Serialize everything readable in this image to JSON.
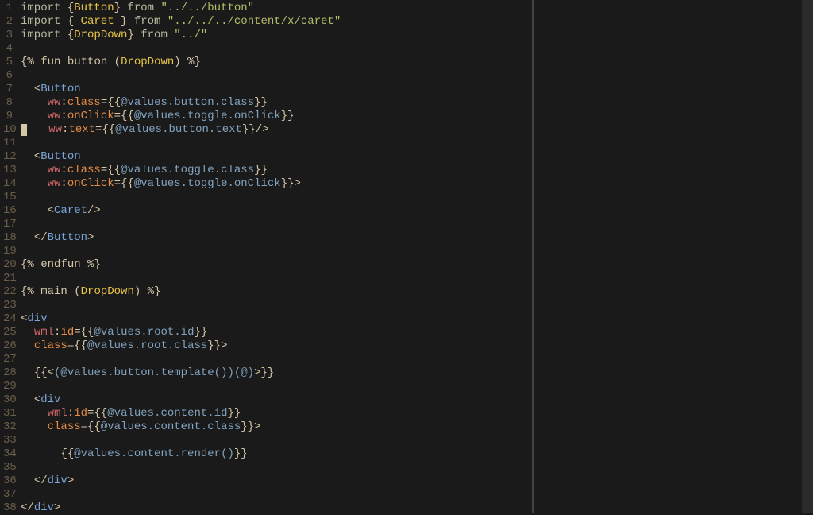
{
  "editor": {
    "current_line": 10,
    "line_numbers": [
      "1",
      "2",
      "3",
      "4",
      "5",
      "6",
      "7",
      "8",
      "9",
      "10",
      "11",
      "12",
      "13",
      "14",
      "15",
      "16",
      "17",
      "18",
      "19",
      "20",
      "21",
      "22",
      "23",
      "24",
      "25",
      "26",
      "27",
      "28",
      "29",
      "30",
      "31",
      "32",
      "33",
      "34",
      "35",
      "36",
      "37",
      "38"
    ],
    "lines": [
      {
        "indent": "",
        "tokens": [
          {
            "t": "import ",
            "c": "tok-import-kw"
          },
          {
            "t": "{",
            "c": "tok-punct"
          },
          {
            "t": "Button",
            "c": "tok-type"
          },
          {
            "t": "}",
            "c": "tok-punct"
          },
          {
            "t": " from ",
            "c": "tok-import-kw"
          },
          {
            "t": "\"../../button\"",
            "c": "tok-string"
          }
        ]
      },
      {
        "indent": "",
        "tokens": [
          {
            "t": "import ",
            "c": "tok-import-kw"
          },
          {
            "t": "{ ",
            "c": "tok-punct"
          },
          {
            "t": "Caret",
            "c": "tok-type"
          },
          {
            "t": " }",
            "c": "tok-punct"
          },
          {
            "t": " from ",
            "c": "tok-import-kw"
          },
          {
            "t": "\"../../../content/x/caret\"",
            "c": "tok-string"
          }
        ]
      },
      {
        "indent": "",
        "tokens": [
          {
            "t": "import ",
            "c": "tok-import-kw"
          },
          {
            "t": "{",
            "c": "tok-punct"
          },
          {
            "t": "DropDown",
            "c": "tok-type"
          },
          {
            "t": "}",
            "c": "tok-punct"
          },
          {
            "t": " from ",
            "c": "tok-import-kw"
          },
          {
            "t": "\"../\"",
            "c": "tok-string"
          }
        ]
      },
      {
        "indent": "",
        "tokens": []
      },
      {
        "indent": "",
        "tokens": [
          {
            "t": "{% ",
            "c": "tok-percent"
          },
          {
            "t": "fun",
            "c": "tok-ident"
          },
          {
            "t": " button ",
            "c": "tok-ident"
          },
          {
            "t": "(",
            "c": "tok-punct"
          },
          {
            "t": "DropDown",
            "c": "tok-type"
          },
          {
            "t": ")",
            "c": "tok-punct"
          },
          {
            "t": " %}",
            "c": "tok-percent"
          }
        ]
      },
      {
        "indent": "",
        "tokens": []
      },
      {
        "indent": "  ",
        "tokens": [
          {
            "t": "<",
            "c": "tok-punct"
          },
          {
            "t": "Button",
            "c": "tok-tag-name"
          }
        ]
      },
      {
        "indent": "    ",
        "tokens": [
          {
            "t": "ww",
            "c": "tok-attr-ns"
          },
          {
            "t": ":",
            "c": "tok-punct"
          },
          {
            "t": "class",
            "c": "tok-attr-name"
          },
          {
            "t": "=",
            "c": "tok-punct"
          },
          {
            "t": "{{",
            "c": "tok-delim"
          },
          {
            "t": "@values.button.class",
            "c": "tok-expr"
          },
          {
            "t": "}}",
            "c": "tok-delim"
          }
        ]
      },
      {
        "indent": "    ",
        "tokens": [
          {
            "t": "ww",
            "c": "tok-attr-ns"
          },
          {
            "t": ":",
            "c": "tok-punct"
          },
          {
            "t": "onClick",
            "c": "tok-attr-name"
          },
          {
            "t": "=",
            "c": "tok-punct"
          },
          {
            "t": "{{",
            "c": "tok-delim"
          },
          {
            "t": "@values.toggle.onClick",
            "c": "tok-expr"
          },
          {
            "t": "}}",
            "c": "tok-delim"
          }
        ]
      },
      {
        "indent": "    ",
        "cursor": true,
        "tokens": [
          {
            "t": "ww",
            "c": "tok-attr-ns"
          },
          {
            "t": ":",
            "c": "tok-punct"
          },
          {
            "t": "text",
            "c": "tok-attr-name"
          },
          {
            "t": "=",
            "c": "tok-punct"
          },
          {
            "t": "{{",
            "c": "tok-delim"
          },
          {
            "t": "@values.button.text",
            "c": "tok-expr"
          },
          {
            "t": "}}",
            "c": "tok-delim"
          },
          {
            "t": "/>",
            "c": "tok-punct"
          }
        ]
      },
      {
        "indent": "",
        "tokens": []
      },
      {
        "indent": "  ",
        "tokens": [
          {
            "t": "<",
            "c": "tok-punct"
          },
          {
            "t": "Button",
            "c": "tok-tag-name"
          }
        ]
      },
      {
        "indent": "    ",
        "tokens": [
          {
            "t": "ww",
            "c": "tok-attr-ns"
          },
          {
            "t": ":",
            "c": "tok-punct"
          },
          {
            "t": "class",
            "c": "tok-attr-name"
          },
          {
            "t": "=",
            "c": "tok-punct"
          },
          {
            "t": "{{",
            "c": "tok-delim"
          },
          {
            "t": "@values.toggle.class",
            "c": "tok-expr"
          },
          {
            "t": "}}",
            "c": "tok-delim"
          }
        ]
      },
      {
        "indent": "    ",
        "tokens": [
          {
            "t": "ww",
            "c": "tok-attr-ns"
          },
          {
            "t": ":",
            "c": "tok-punct"
          },
          {
            "t": "onClick",
            "c": "tok-attr-name"
          },
          {
            "t": "=",
            "c": "tok-punct"
          },
          {
            "t": "{{",
            "c": "tok-delim"
          },
          {
            "t": "@values.toggle.onClick",
            "c": "tok-expr"
          },
          {
            "t": "}}",
            "c": "tok-delim"
          },
          {
            "t": ">",
            "c": "tok-punct"
          }
        ]
      },
      {
        "indent": "",
        "tokens": []
      },
      {
        "indent": "    ",
        "tokens": [
          {
            "t": "<",
            "c": "tok-punct"
          },
          {
            "t": "Caret",
            "c": "tok-tag-name"
          },
          {
            "t": "/>",
            "c": "tok-punct"
          }
        ]
      },
      {
        "indent": "",
        "tokens": []
      },
      {
        "indent": "  ",
        "tokens": [
          {
            "t": "</",
            "c": "tok-punct"
          },
          {
            "t": "Button",
            "c": "tok-tag-name"
          },
          {
            "t": ">",
            "c": "tok-punct"
          }
        ]
      },
      {
        "indent": "",
        "tokens": []
      },
      {
        "indent": "",
        "tokens": [
          {
            "t": "{% ",
            "c": "tok-percent"
          },
          {
            "t": "endfun",
            "c": "tok-ident"
          },
          {
            "t": " %}",
            "c": "tok-percent"
          }
        ]
      },
      {
        "indent": "",
        "tokens": []
      },
      {
        "indent": "",
        "tokens": [
          {
            "t": "{% ",
            "c": "tok-percent"
          },
          {
            "t": "main",
            "c": "tok-ident"
          },
          {
            "t": " (",
            "c": "tok-punct"
          },
          {
            "t": "DropDown",
            "c": "tok-type"
          },
          {
            "t": ")",
            "c": "tok-punct"
          },
          {
            "t": " %}",
            "c": "tok-percent"
          }
        ]
      },
      {
        "indent": "",
        "tokens": []
      },
      {
        "indent": "",
        "tokens": [
          {
            "t": "<",
            "c": "tok-punct"
          },
          {
            "t": "div",
            "c": "tok-tag-name"
          }
        ]
      },
      {
        "indent": "  ",
        "tokens": [
          {
            "t": "wml",
            "c": "tok-attr-ns"
          },
          {
            "t": ":",
            "c": "tok-punct"
          },
          {
            "t": "id",
            "c": "tok-attr-name"
          },
          {
            "t": "=",
            "c": "tok-punct"
          },
          {
            "t": "{{",
            "c": "tok-delim"
          },
          {
            "t": "@values.root.id",
            "c": "tok-expr"
          },
          {
            "t": "}}",
            "c": "tok-delim"
          }
        ]
      },
      {
        "indent": "  ",
        "tokens": [
          {
            "t": "class",
            "c": "tok-attr-name"
          },
          {
            "t": "=",
            "c": "tok-punct"
          },
          {
            "t": "{{",
            "c": "tok-delim"
          },
          {
            "t": "@values.root.class",
            "c": "tok-expr"
          },
          {
            "t": "}}",
            "c": "tok-delim"
          },
          {
            "t": ">",
            "c": "tok-punct"
          }
        ]
      },
      {
        "indent": "",
        "tokens": []
      },
      {
        "indent": "  ",
        "tokens": [
          {
            "t": "{{",
            "c": "tok-delim"
          },
          {
            "t": "<",
            "c": "tok-punct"
          },
          {
            "t": "(@values.button.template())(@)",
            "c": "tok-expr"
          },
          {
            "t": ">",
            "c": "tok-punct"
          },
          {
            "t": "}}",
            "c": "tok-delim"
          }
        ]
      },
      {
        "indent": "",
        "tokens": []
      },
      {
        "indent": "  ",
        "tokens": [
          {
            "t": "<",
            "c": "tok-punct"
          },
          {
            "t": "div",
            "c": "tok-tag-name"
          }
        ]
      },
      {
        "indent": "    ",
        "tokens": [
          {
            "t": "wml",
            "c": "tok-attr-ns"
          },
          {
            "t": ":",
            "c": "tok-punct"
          },
          {
            "t": "id",
            "c": "tok-attr-name"
          },
          {
            "t": "=",
            "c": "tok-punct"
          },
          {
            "t": "{{",
            "c": "tok-delim"
          },
          {
            "t": "@values.content.id",
            "c": "tok-expr"
          },
          {
            "t": "}}",
            "c": "tok-delim"
          }
        ]
      },
      {
        "indent": "    ",
        "tokens": [
          {
            "t": "class",
            "c": "tok-attr-name"
          },
          {
            "t": "=",
            "c": "tok-punct"
          },
          {
            "t": "{{",
            "c": "tok-delim"
          },
          {
            "t": "@values.content.class",
            "c": "tok-expr"
          },
          {
            "t": "}}",
            "c": "tok-delim"
          },
          {
            "t": ">",
            "c": "tok-punct"
          }
        ]
      },
      {
        "indent": "",
        "tokens": []
      },
      {
        "indent": "      ",
        "tokens": [
          {
            "t": "{{",
            "c": "tok-delim"
          },
          {
            "t": "@values.content.render()",
            "c": "tok-expr"
          },
          {
            "t": "}}",
            "c": "tok-delim"
          }
        ]
      },
      {
        "indent": "",
        "tokens": []
      },
      {
        "indent": "  ",
        "tokens": [
          {
            "t": "</",
            "c": "tok-punct"
          },
          {
            "t": "div",
            "c": "tok-tag-name"
          },
          {
            "t": ">",
            "c": "tok-punct"
          }
        ]
      },
      {
        "indent": "",
        "tokens": []
      },
      {
        "indent": "",
        "tokens": [
          {
            "t": "</",
            "c": "tok-punct"
          },
          {
            "t": "div",
            "c": "tok-tag-name"
          },
          {
            "t": ">",
            "c": "tok-punct"
          }
        ]
      }
    ]
  }
}
